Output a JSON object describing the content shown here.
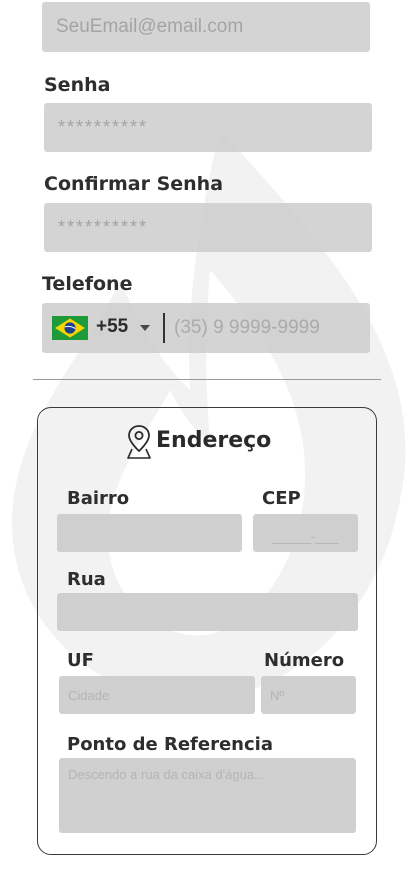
{
  "form": {
    "email": {
      "placeholder": "SeuEmail@email.com"
    },
    "senha": {
      "label": "Senha",
      "placeholder": "**********"
    },
    "confirmar_senha": {
      "label": "Confirmar Senha",
      "placeholder": "**********"
    },
    "telefone": {
      "label": "Telefone",
      "dial_code": "+55",
      "country_flag": "brazil-flag-icon",
      "placeholder": "(35) 9 9999-9999"
    }
  },
  "address_card": {
    "icon": "map-pin-icon",
    "title": "Endereço",
    "bairro": {
      "label": "Bairro",
      "placeholder": ""
    },
    "cep": {
      "label": "CEP",
      "placeholder": "_____-___"
    },
    "rua": {
      "label": "Rua",
      "placeholder": ""
    },
    "uf": {
      "label": "UF",
      "placeholder": "Cidade"
    },
    "numero": {
      "label": "Número",
      "placeholder": "Nº"
    },
    "ponto_referencia": {
      "label": "Ponto de Referencia",
      "placeholder": "Descendo a rua da caixa d'água..."
    }
  },
  "colors": {
    "field_bg": "#cdcdcd",
    "text_dark": "#2e2e2e",
    "placeholder": "#a4a4a4",
    "flag_green": "#1f9a3a",
    "flag_yellow": "#f5d400",
    "flag_blue": "#1e3f8f"
  }
}
